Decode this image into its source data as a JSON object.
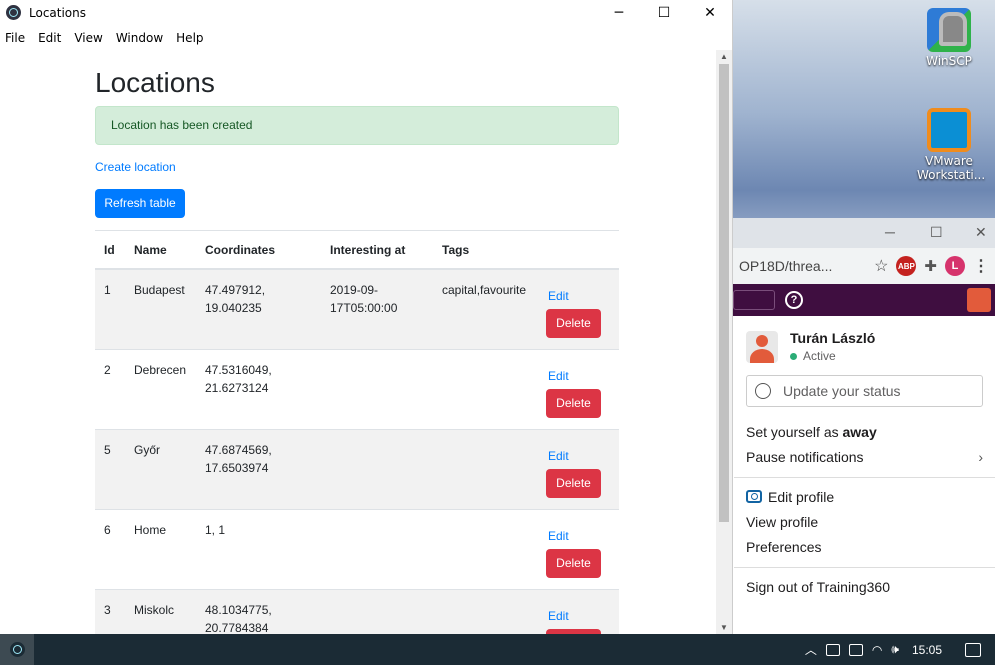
{
  "window": {
    "title": "Locations",
    "minimize": "─",
    "maximize": "☐",
    "close": "✕"
  },
  "menu": [
    "File",
    "Edit",
    "View",
    "Window",
    "Help"
  ],
  "page": {
    "heading": "Locations",
    "alert": "Location has been created",
    "create_link": "Create location",
    "refresh_button": "Refresh table"
  },
  "table": {
    "headers": [
      "Id",
      "Name",
      "Coordinates",
      "Interesting at",
      "Tags",
      ""
    ],
    "edit_label": "Edit",
    "delete_label": "Delete",
    "rows": [
      {
        "id": "1",
        "name": "Budapest",
        "coord1": "47.497912,",
        "coord2": "19.040235",
        "int1": "2019-09-",
        "int2": "17T05:00:00",
        "tags": "capital,favourite"
      },
      {
        "id": "2",
        "name": "Debrecen",
        "coord1": "47.5316049,",
        "coord2": "21.6273124",
        "int1": "",
        "int2": "",
        "tags": ""
      },
      {
        "id": "5",
        "name": "Győr",
        "coord1": "47.6874569,",
        "coord2": "17.6503974",
        "int1": "",
        "int2": "",
        "tags": ""
      },
      {
        "id": "6",
        "name": "Home",
        "coord1": "1, 1",
        "coord2": "",
        "int1": "",
        "int2": "",
        "tags": ""
      },
      {
        "id": "3",
        "name": "Miskolc",
        "coord1": "48.1034775,",
        "coord2": "20.7784384",
        "int1": "",
        "int2": "",
        "tags": ""
      }
    ]
  },
  "desktop": {
    "icons": [
      {
        "label": "WinSCP"
      },
      {
        "label": "VMware Workstati..."
      }
    ]
  },
  "browser": {
    "url": "OP18D/threa...",
    "extensions": [
      "ABP",
      "L"
    ],
    "profile_menu": {
      "name": "Turán László",
      "status": "Active",
      "status_placeholder": "Update your status",
      "away_prefix": "Set yourself as ",
      "away_bold": "away",
      "pause": "Pause notifications",
      "edit_profile": "Edit profile",
      "view_profile": "View profile",
      "preferences": "Preferences",
      "sign_out": "Sign out of Training360"
    }
  },
  "taskbar": {
    "time": "15:05"
  },
  "colors": {
    "primary": "#007bff",
    "danger": "#dc3545",
    "success_bg": "#d4edda",
    "slack_purple": "#3f0e40"
  }
}
